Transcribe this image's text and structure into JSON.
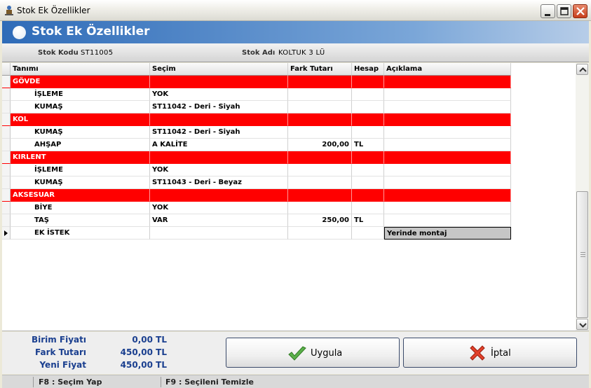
{
  "window": {
    "title": "Stok Ek Özellikler"
  },
  "header": {
    "title": "Stok Ek Özellikler"
  },
  "info": {
    "stok_kodu_label": "Stok Kodu",
    "stok_kodu_value": "ST11005",
    "stok_adi_label": "Stok Adı",
    "stok_adi_value": "KOLTUK 3 LÜ"
  },
  "grid": {
    "columns": [
      "Tanımı",
      "Seçim",
      "Fark Tutarı",
      "Hesap",
      "Açıklama"
    ],
    "rows": [
      {
        "type": "group",
        "tanimi": "GÖVDE",
        "secim": "",
        "fark": "",
        "hesap": "",
        "aciklama": ""
      },
      {
        "type": "item",
        "tanimi": "İŞLEME",
        "secim": "YOK",
        "fark": "",
        "hesap": "",
        "aciklama": ""
      },
      {
        "type": "item",
        "tanimi": "KUMAŞ",
        "secim": "ST11042 - Deri - Siyah",
        "fark": "",
        "hesap": "",
        "aciklama": ""
      },
      {
        "type": "group",
        "tanimi": "KOL",
        "secim": "",
        "fark": "",
        "hesap": "",
        "aciklama": ""
      },
      {
        "type": "item",
        "tanimi": "KUMAŞ",
        "secim": "ST11042 - Deri - Siyah",
        "fark": "",
        "hesap": "",
        "aciklama": ""
      },
      {
        "type": "item",
        "tanimi": "AHŞAP",
        "secim": "A KALİTE",
        "fark": "200,00",
        "hesap": "TL",
        "aciklama": ""
      },
      {
        "type": "group",
        "tanimi": "KIRLENT",
        "secim": "",
        "fark": "",
        "hesap": "",
        "aciklama": ""
      },
      {
        "type": "item",
        "tanimi": "İŞLEME",
        "secim": "YOK",
        "fark": "",
        "hesap": "",
        "aciklama": ""
      },
      {
        "type": "item",
        "tanimi": "KUMAŞ",
        "secim": "ST11043 - Deri - Beyaz",
        "fark": "",
        "hesap": "",
        "aciklama": ""
      },
      {
        "type": "group",
        "tanimi": "AKSESUAR",
        "secim": "",
        "fark": "",
        "hesap": "",
        "aciklama": ""
      },
      {
        "type": "item",
        "tanimi": "BİYE",
        "secim": "YOK",
        "fark": "",
        "hesap": "",
        "aciklama": ""
      },
      {
        "type": "item",
        "tanimi": "TAŞ",
        "secim": "VAR",
        "fark": "250,00",
        "hesap": "TL",
        "aciklama": ""
      },
      {
        "type": "current",
        "tanimi": "EK İSTEK",
        "secim": "",
        "fark": "",
        "hesap": "",
        "aciklama": "Yerinde montaj"
      }
    ]
  },
  "summary": {
    "birim_label": "Birim Fiyatı",
    "birim_value": "0,00 TL",
    "fark_label": "Fark Tutarı",
    "fark_value": "450,00 TL",
    "yeni_label": "Yeni Fiyat",
    "yeni_value": "450,00 TL"
  },
  "buttons": {
    "apply_label": "Uygula",
    "cancel_label": "İptal"
  },
  "statusbar": {
    "f8": "F8 : Seçim Yap",
    "f9": "F9 : Seçileni Temizle"
  },
  "colors": {
    "group_row": "#ff0000",
    "header_blue": "#2e6bb8",
    "summary_text": "#1a3f8f"
  },
  "icons": {
    "apply": "checkmark-icon",
    "cancel": "x-cross-icon"
  }
}
